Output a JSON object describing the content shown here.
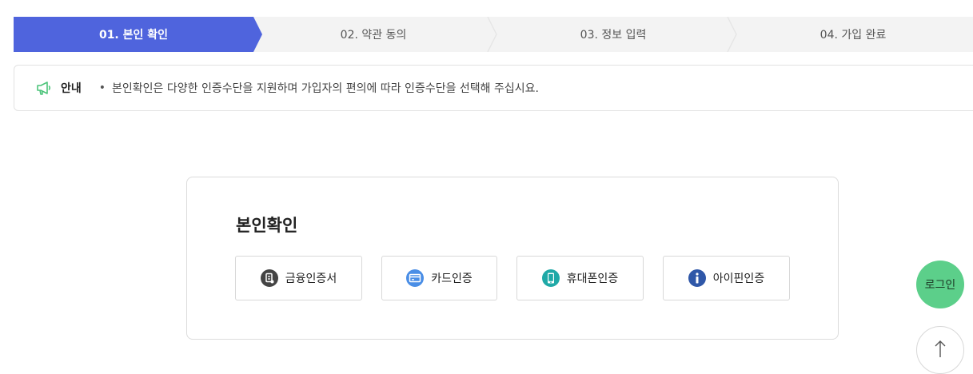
{
  "steps": [
    {
      "label": "01. 본인 확인",
      "active": true
    },
    {
      "label": "02. 약관 동의",
      "active": false
    },
    {
      "label": "03. 정보 입력",
      "active": false
    },
    {
      "label": "04. 가입 완료",
      "active": false
    }
  ],
  "notice": {
    "icon": "megaphone-icon",
    "title": "안내",
    "bullet": "•",
    "text": "본인확인은 다양한 인증수단을 지원하며 가입자의 편의에 따라 인증수단을 선택해 주십시요."
  },
  "verify": {
    "title": "본인확인",
    "methods": [
      {
        "label": "금융인증서",
        "icon": "certificate-icon",
        "color": "#444444"
      },
      {
        "label": "카드인증",
        "icon": "credit-card-icon",
        "color": "#4a8ee6"
      },
      {
        "label": "휴대폰인증",
        "icon": "mobile-phone-icon",
        "color": "#1fa9a7"
      },
      {
        "label": "아이핀인증",
        "icon": "info-icon",
        "color": "#2f57a8"
      }
    ]
  },
  "floating": {
    "login_label": "로그인",
    "top_icon": "arrow-up-icon"
  },
  "colors": {
    "accent": "#4f64dd",
    "login": "#5ccf8a"
  }
}
